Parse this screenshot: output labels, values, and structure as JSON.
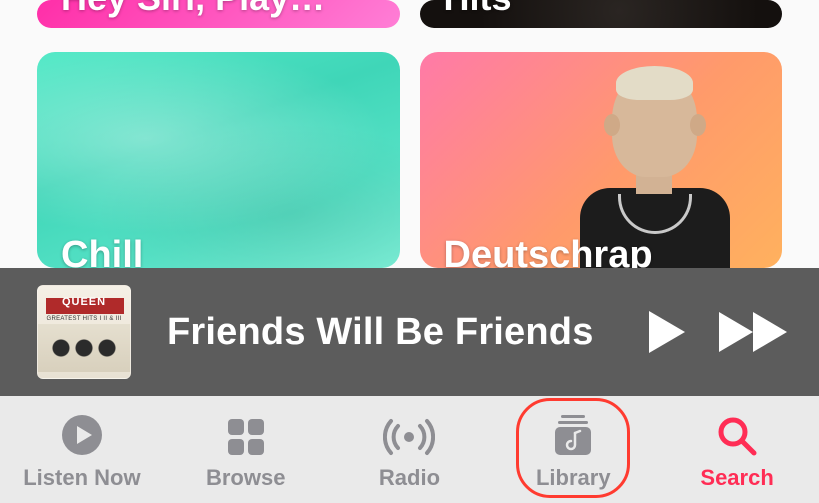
{
  "colors": {
    "accent": "#ff2d55",
    "highlight_ring": "#ff3b30",
    "player_bg": "#5c5c5c",
    "tabbar_bg": "#eaeaea",
    "inactive": "#8e8e93"
  },
  "cards": {
    "hey_siri": {
      "label": "Hey Siri, Play…"
    },
    "hits": {
      "label": "Hits"
    },
    "chill": {
      "label": "Chill"
    },
    "deutschrap": {
      "label": "Deutschrap"
    }
  },
  "player": {
    "album_artist": "QUEEN",
    "album_subtitle": "GREATEST HITS I II & III",
    "track_title": "Friends Will Be Friends",
    "play_icon": "play-icon",
    "forward_icon": "fast-forward-icon"
  },
  "tabs": {
    "listen_now": {
      "label": "Listen Now"
    },
    "browse": {
      "label": "Browse"
    },
    "radio": {
      "label": "Radio"
    },
    "library": {
      "label": "Library",
      "highlighted": true
    },
    "search": {
      "label": "Search"
    }
  }
}
